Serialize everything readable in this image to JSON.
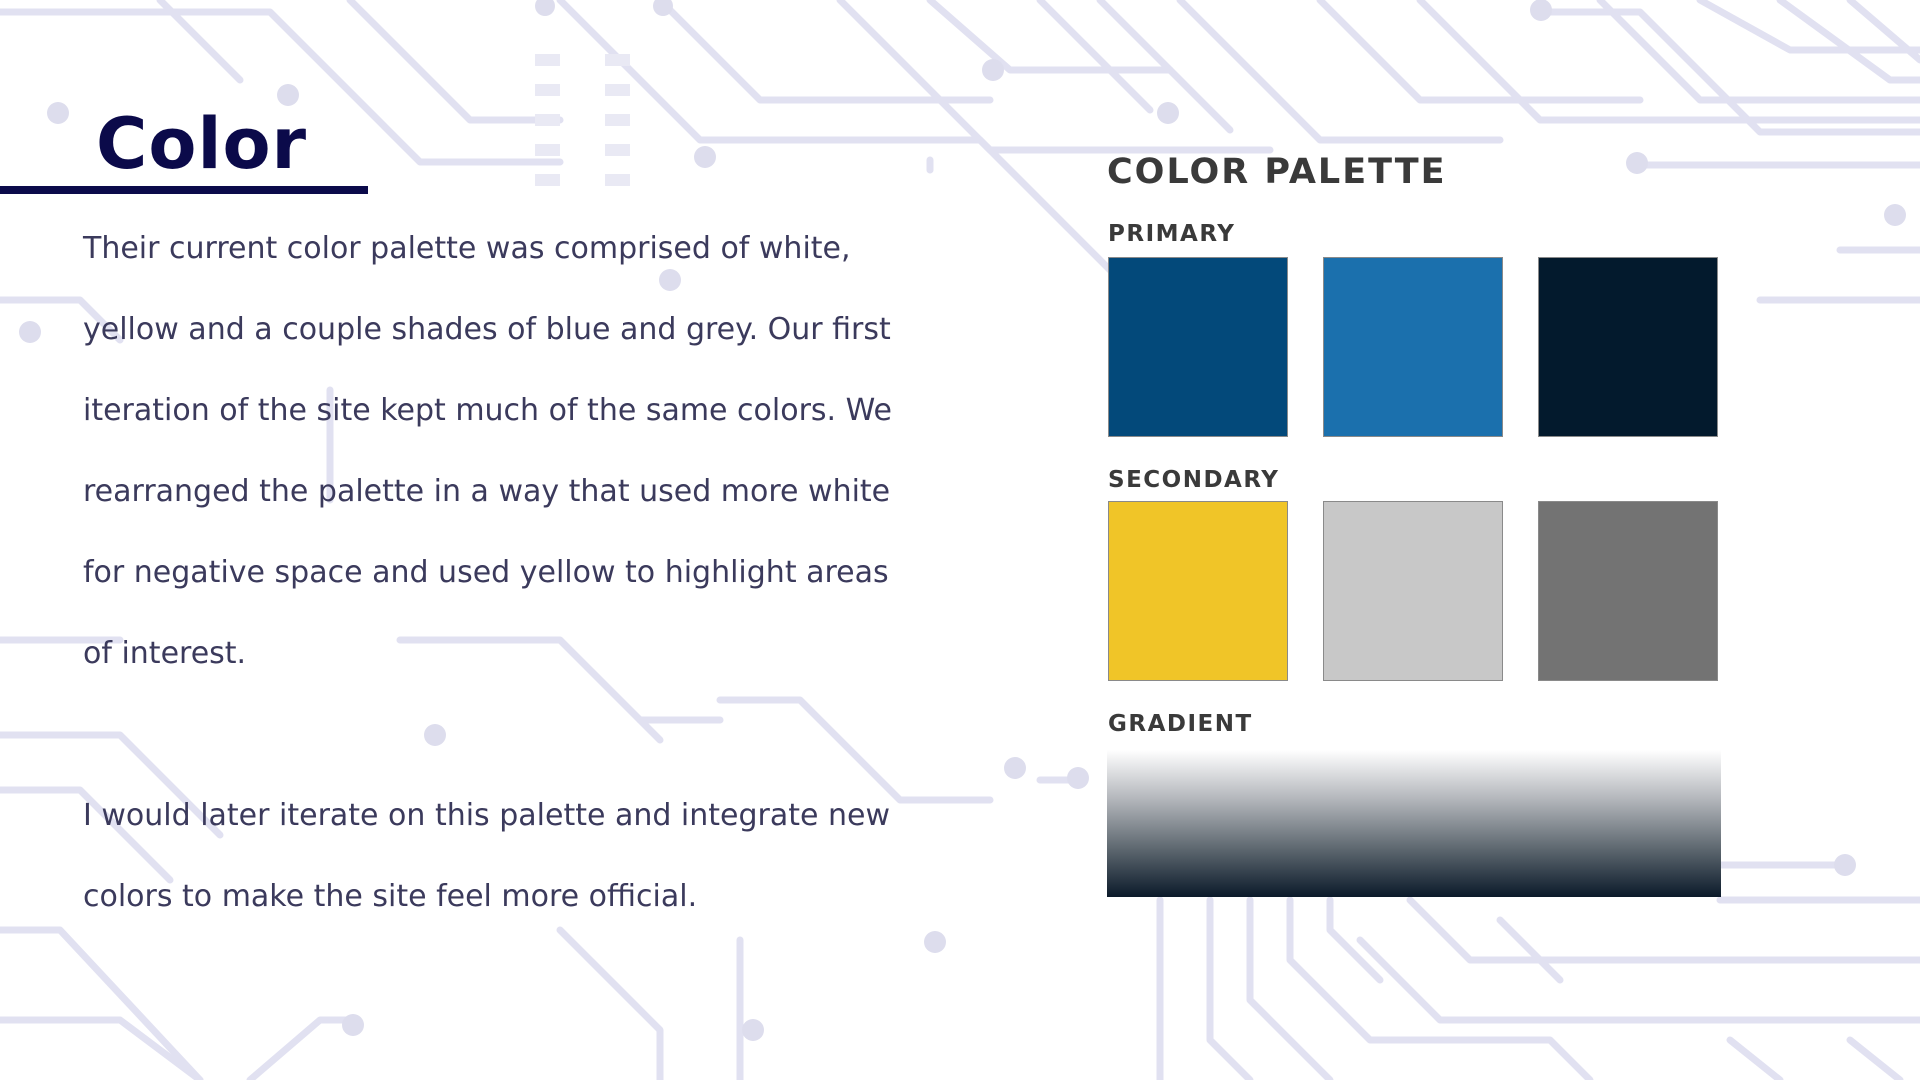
{
  "slide": {
    "title": "Color",
    "paragraph_1": "Their current color palette was comprised of white, yellow and a couple shades of blue and grey. Our first iteration of the site kept much of the same colors. We rearranged the palette in a way that used more white for negative space and used yellow to highlight areas of interest.",
    "paragraph_2": "I would later iterate on this palette and integrate new colors to make the site feel more official."
  },
  "palette": {
    "heading": "COLOR PALETTE",
    "primary_label": "PRIMARY",
    "secondary_label": "SECONDARY",
    "gradient_label": "GRADIENT",
    "primary_colors": [
      "#03497a",
      "#1b70ad",
      "#031a2d"
    ],
    "secondary_colors": [
      "#f0c528",
      "#c8c8c8",
      "#737373"
    ],
    "gradient_colors": [
      "#ffffff",
      "#b4b7bc",
      "#5e6870",
      "#0b1a2a"
    ]
  },
  "colors": {
    "title": "#0b0a4a",
    "body_text": "#3b3a5c",
    "circuit_lines": "#dcdcef"
  }
}
